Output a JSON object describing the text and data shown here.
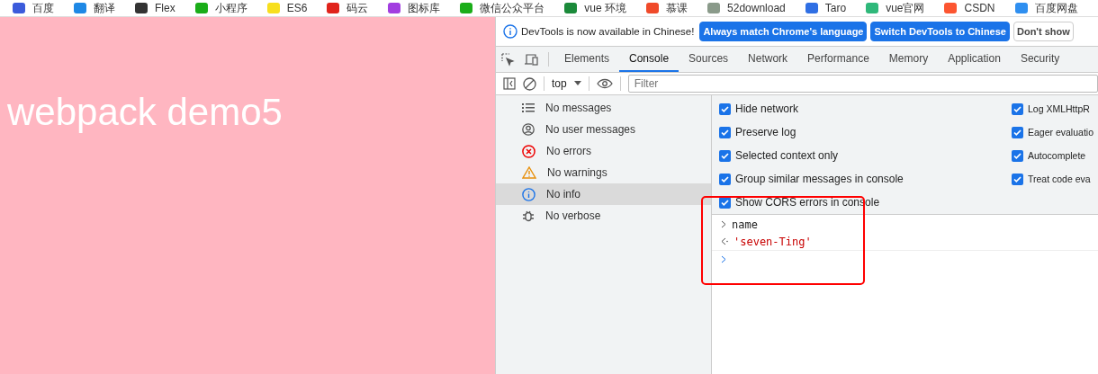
{
  "bookmarks": [
    {
      "label": "百度",
      "color": "#3b5bdb"
    },
    {
      "label": "翻译",
      "color": "#1e88e5"
    },
    {
      "label": "Flex",
      "color": "#333333"
    },
    {
      "label": "小程序",
      "color": "#1aad19"
    },
    {
      "label": "ES6",
      "color": "#f7df1e"
    },
    {
      "label": "码云",
      "color": "#e0231b"
    },
    {
      "label": "图标库",
      "color": "#a23ee0"
    },
    {
      "label": "微信公众平台",
      "color": "#1aad19"
    },
    {
      "label": "vue 环境",
      "color": "#1b8a3a"
    },
    {
      "label": "慕课",
      "color": "#f04a2a"
    },
    {
      "label": "52download",
      "color": "#8a9a8a"
    },
    {
      "label": "Taro",
      "color": "#2f6fe4"
    },
    {
      "label": "vue官网",
      "color": "#2fb87a"
    },
    {
      "label": "CSDN",
      "color": "#fc5531"
    },
    {
      "label": "百度网盘",
      "color": "#2f8ff0"
    }
  ],
  "page": {
    "heading": "webpack demo5"
  },
  "infobar": {
    "message": "DevTools is now available in Chinese!",
    "buttons": [
      {
        "label": "Always match Chrome's language",
        "kind": "primary"
      },
      {
        "label": "Switch DevTools to Chinese",
        "kind": "primary"
      },
      {
        "label": "Don't show",
        "kind": "plain"
      }
    ]
  },
  "tabs": [
    {
      "label": "Elements",
      "selected": false
    },
    {
      "label": "Console",
      "selected": true
    },
    {
      "label": "Sources",
      "selected": false
    },
    {
      "label": "Network",
      "selected": false
    },
    {
      "label": "Performance",
      "selected": false
    },
    {
      "label": "Memory",
      "selected": false
    },
    {
      "label": "Application",
      "selected": false
    },
    {
      "label": "Security",
      "selected": false
    }
  ],
  "toolbar": {
    "context": "top",
    "filter_placeholder": "Filter"
  },
  "sidebar": [
    {
      "label": "No messages",
      "kind": "list",
      "selected": false
    },
    {
      "label": "No user messages",
      "kind": "user",
      "selected": false
    },
    {
      "label": "No errors",
      "kind": "error",
      "selected": false
    },
    {
      "label": "No warnings",
      "kind": "warning",
      "selected": false
    },
    {
      "label": "No info",
      "kind": "info",
      "selected": true
    },
    {
      "label": "No verbose",
      "kind": "verbose",
      "selected": false
    }
  ],
  "settings_left": [
    {
      "label": "Hide network",
      "checked": true
    },
    {
      "label": "Preserve log",
      "checked": true
    },
    {
      "label": "Selected context only",
      "checked": true
    },
    {
      "label": "Group similar messages in console",
      "checked": true
    },
    {
      "label": "Show CORS errors in console",
      "checked": true
    }
  ],
  "settings_right": [
    {
      "label": "Log XMLHttpR",
      "checked": true
    },
    {
      "label": "Eager evaluatio",
      "checked": true
    },
    {
      "label": "Autocomplete",
      "checked": true
    },
    {
      "label": "Treat code eva",
      "checked": true
    }
  ],
  "console": [
    {
      "kind": "input",
      "text": "name"
    },
    {
      "kind": "result",
      "text": "'seven-Ting'"
    },
    {
      "kind": "prompt"
    }
  ]
}
